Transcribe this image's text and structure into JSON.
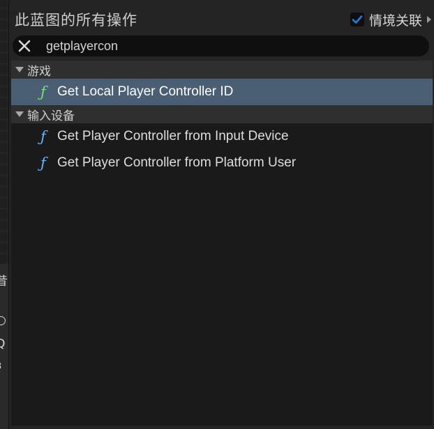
{
  "palette": {
    "title": "此蓝图的所有操作",
    "context_sensitive": {
      "label": "情境关联",
      "checked": true
    }
  },
  "search": {
    "value": "getplayercon"
  },
  "tree": {
    "categories": [
      {
        "label": "游戏",
        "items": [
          {
            "label": "Get Local Player Controller ID",
            "icon": "function-icon",
            "selected": true
          }
        ]
      },
      {
        "label": "输入设备",
        "items": [
          {
            "label": "Get Player Controller from Input Device",
            "icon": "function-icon",
            "selected": false
          },
          {
            "label": "Get Player Controller from Platform User",
            "icon": "function-icon",
            "selected": false
          }
        ]
      }
    ]
  },
  "colors": {
    "selection": "#4a5e74",
    "checkbox_check": "#1f7fe0",
    "function_icon": "#5fb5ff",
    "function_icon_selected": "#78e07a"
  }
}
